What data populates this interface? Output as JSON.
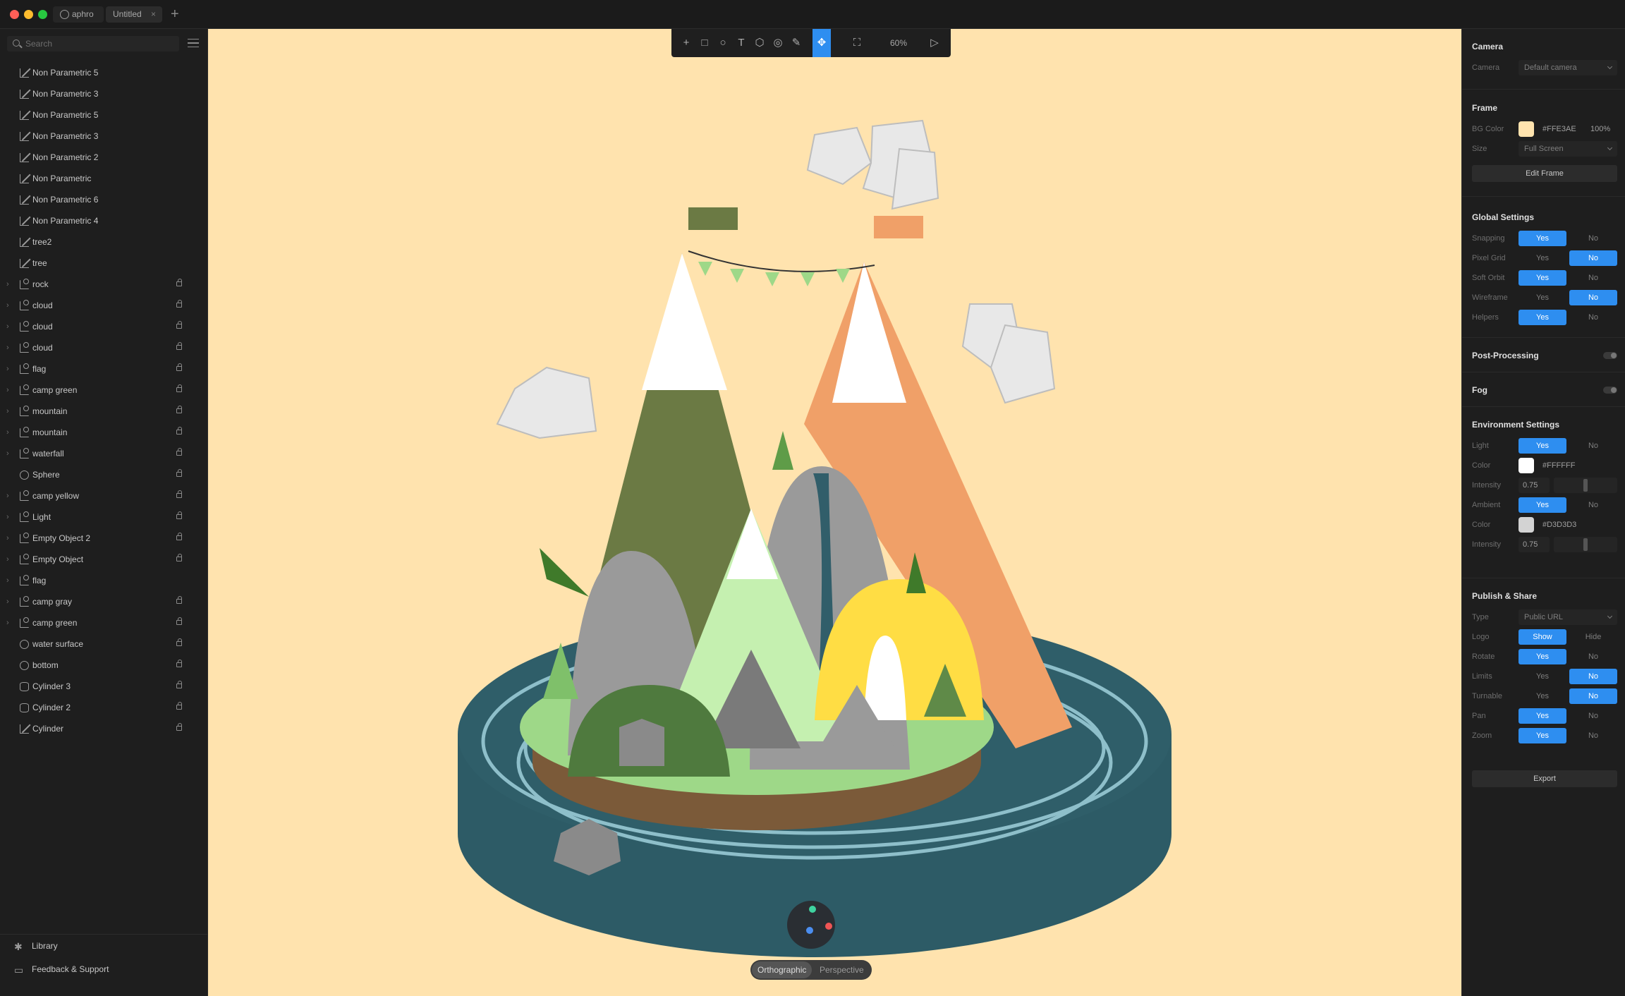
{
  "window": {
    "app_tab": "aphro",
    "doc_tab": "Untitled",
    "close_glyph": "×",
    "add_glyph": "+"
  },
  "left": {
    "search_placeholder": "Search",
    "layers": [
      {
        "name": "Non Parametric 5",
        "icon": "path-icon",
        "expand": false,
        "locked": false
      },
      {
        "name": "Non Parametric 3",
        "icon": "path-icon",
        "expand": false,
        "locked": false
      },
      {
        "name": "Non Parametric 5",
        "icon": "path-icon",
        "expand": false,
        "locked": false
      },
      {
        "name": "Non Parametric 3",
        "icon": "path-icon",
        "expand": false,
        "locked": false
      },
      {
        "name": "Non Parametric 2",
        "icon": "path-icon",
        "expand": false,
        "locked": false
      },
      {
        "name": "Non Parametric",
        "icon": "path-icon",
        "expand": false,
        "locked": false
      },
      {
        "name": "Non Parametric 6",
        "icon": "path-icon",
        "expand": false,
        "locked": false
      },
      {
        "name": "Non Parametric 4",
        "icon": "path-icon",
        "expand": false,
        "locked": false
      },
      {
        "name": "tree2",
        "icon": "path-icon",
        "expand": false,
        "locked": false
      },
      {
        "name": "tree",
        "icon": "path-icon",
        "expand": false,
        "locked": false
      },
      {
        "name": "rock",
        "icon": "group-icon",
        "expand": true,
        "locked": true
      },
      {
        "name": "cloud",
        "icon": "group-icon",
        "expand": true,
        "locked": true
      },
      {
        "name": "cloud",
        "icon": "group-icon",
        "expand": true,
        "locked": true
      },
      {
        "name": "cloud",
        "icon": "group-icon",
        "expand": true,
        "locked": true
      },
      {
        "name": "flag",
        "icon": "group-icon",
        "expand": true,
        "locked": true
      },
      {
        "name": "camp green",
        "icon": "group-icon",
        "expand": true,
        "locked": true
      },
      {
        "name": "mountain",
        "icon": "group-icon",
        "expand": true,
        "locked": true
      },
      {
        "name": "mountain",
        "icon": "group-icon",
        "expand": true,
        "locked": true
      },
      {
        "name": "waterfall",
        "icon": "group-icon",
        "expand": true,
        "locked": true
      },
      {
        "name": "Sphere",
        "icon": "sphere-icon",
        "expand": false,
        "locked": true
      },
      {
        "name": "camp yellow",
        "icon": "group-icon",
        "expand": true,
        "locked": true
      },
      {
        "name": "Light",
        "icon": "group-icon",
        "expand": true,
        "locked": true
      },
      {
        "name": "Empty Object 2",
        "icon": "group-icon",
        "expand": true,
        "locked": true
      },
      {
        "name": "Empty Object",
        "icon": "group-icon",
        "expand": true,
        "locked": true
      },
      {
        "name": "flag",
        "icon": "group-icon",
        "expand": true,
        "locked": false
      },
      {
        "name": "camp gray",
        "icon": "group-icon",
        "expand": true,
        "locked": true
      },
      {
        "name": "camp green",
        "icon": "group-icon",
        "expand": true,
        "locked": true
      },
      {
        "name": "water surface",
        "icon": "circle-icon",
        "expand": false,
        "locked": true
      },
      {
        "name": "bottom",
        "icon": "circle-icon",
        "expand": false,
        "locked": true
      },
      {
        "name": "Cylinder 3",
        "icon": "cylinder-icon",
        "expand": false,
        "locked": true
      },
      {
        "name": "Cylinder 2",
        "icon": "cylinder-icon",
        "expand": false,
        "locked": true
      },
      {
        "name": "Cylinder",
        "icon": "path-icon",
        "expand": false,
        "locked": true
      }
    ],
    "library": "Library",
    "feedback": "Feedback & Support"
  },
  "canvas": {
    "bg_color": "#FFE3AE",
    "zoom": "60%",
    "tools": [
      "plus-icon",
      "rectangle-icon",
      "circle-icon",
      "text-icon",
      "polyhedron-icon",
      "sphere-icon",
      "pen-icon",
      "move-icon",
      "frame-icon",
      "play-icon"
    ],
    "active_tool": "move-icon",
    "view_ortho": "Orthographic",
    "view_persp": "Perspective"
  },
  "right": {
    "camera": {
      "title": "Camera",
      "label": "Camera",
      "value": "Default camera"
    },
    "frame": {
      "title": "Frame",
      "bg_label": "BG Color",
      "bg_hex": "#FFE3AE",
      "bg_opacity": "100%",
      "size_label": "Size",
      "size_value": "Full Screen",
      "edit_button": "Edit Frame"
    },
    "global": {
      "title": "Global Settings",
      "rows": [
        {
          "label": "Snapping",
          "yes": "Yes",
          "no": "No",
          "value": "Yes"
        },
        {
          "label": "Pixel Grid",
          "yes": "Yes",
          "no": "No",
          "value": "No"
        },
        {
          "label": "Soft Orbit",
          "yes": "Yes",
          "no": "No",
          "value": "Yes"
        },
        {
          "label": "Wireframe",
          "yes": "Yes",
          "no": "No",
          "value": "No"
        },
        {
          "label": "Helpers",
          "yes": "Yes",
          "no": "No",
          "value": "Yes"
        }
      ]
    },
    "post_processing": {
      "title": "Post-Processing",
      "enabled": false
    },
    "fog": {
      "title": "Fog",
      "enabled": false
    },
    "environment": {
      "title": "Environment Settings",
      "light_label": "Light",
      "light_value": "Yes",
      "light_color_label": "Color",
      "light_color": "#FFFFFF",
      "light_intensity_label": "Intensity",
      "light_intensity": "0.75",
      "ambient_label": "Ambient",
      "ambient_value": "Yes",
      "ambient_color_label": "Color",
      "ambient_color": "#D3D3D3",
      "ambient_intensity_label": "Intensity",
      "ambient_intensity": "0.75",
      "yes": "Yes",
      "no": "No"
    },
    "publish": {
      "title": "Publish & Share",
      "type_label": "Type",
      "type_value": "Public URL",
      "logo_label": "Logo",
      "logo_show": "Show",
      "logo_hide": "Hide",
      "logo_value": "Show",
      "rows": [
        {
          "label": "Rotate",
          "yes": "Yes",
          "no": "No",
          "value": "Yes"
        },
        {
          "label": "Limits",
          "yes": "Yes",
          "no": "No",
          "value": "No"
        },
        {
          "label": "Turnable",
          "yes": "Yes",
          "no": "No",
          "value": "No"
        },
        {
          "label": "Pan",
          "yes": "Yes",
          "no": "No",
          "value": "Yes"
        },
        {
          "label": "Zoom",
          "yes": "Yes",
          "no": "No",
          "value": "Yes"
        }
      ],
      "export": "Export"
    }
  }
}
